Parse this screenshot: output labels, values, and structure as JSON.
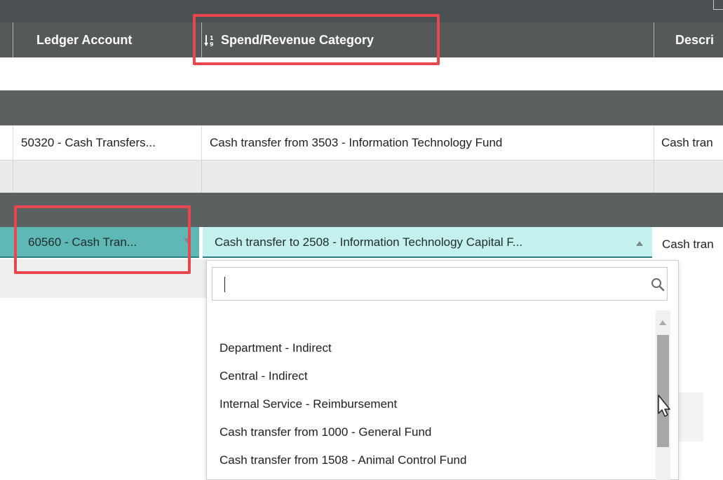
{
  "grid": {
    "columns": [
      {
        "label": ""
      },
      {
        "label": "Ledger Account"
      },
      {
        "label": "Spend/Revenue Category",
        "sorted": true
      },
      {
        "label": "Descri"
      }
    ],
    "rows": [
      {
        "ledger_account": "50320 - Cash Transfers...",
        "category": "Cash transfer from 3503 - Information Technology Fund",
        "description": "Cash tran"
      }
    ],
    "editing_row": {
      "ledger_account": "60560 - Cash Tran...",
      "category": "Cash transfer to 2508 - Information Technology Capital F...",
      "description": "Cash tran"
    }
  },
  "dropdown": {
    "search_value": "",
    "search_placeholder": "",
    "items": [
      "Department - Indirect",
      "Central - Indirect",
      "Internal Service - Reimbursement",
      "Cash transfer from 1000 - General Fund",
      "Cash transfer from 1508 - Animal Control Fund"
    ]
  },
  "colors": {
    "header_bg": "#55595a",
    "group_bar": "#5b6061",
    "edit_teal": "#5fb8b6",
    "edit_light": "#c4f1ee",
    "annotation_red": "#e8474f"
  },
  "icons": {
    "sort": "sort-icon",
    "search": "search-icon",
    "dropdown_arrow": "chevron-down-icon",
    "collapse_arrow": "chevron-up-icon"
  }
}
